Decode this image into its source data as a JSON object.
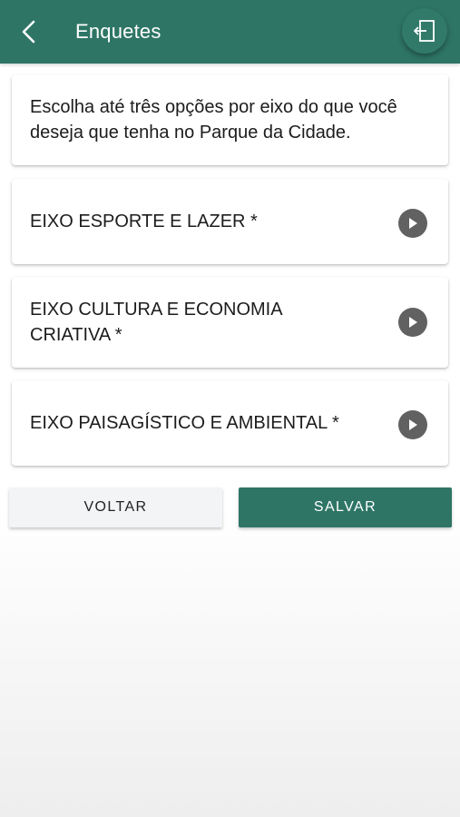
{
  "app_bar": {
    "title": "Enquetes",
    "back_icon": "chevron-left-icon",
    "exit_icon": "logout-icon",
    "background_color": "#2e7565"
  },
  "intro": {
    "text": "Escolha até três opções por eixo do que você deseja que tenha no Parque da Cidade."
  },
  "axes": [
    {
      "label": "EIXO ESPORTE E LAZER *",
      "icon": "play-circle-icon"
    },
    {
      "label": "EIXO CULTURA E ECONOMIA CRIATIVA *",
      "icon": "play-circle-icon"
    },
    {
      "label": "EIXO PAISAGÍSTICO E AMBIENTAL *",
      "icon": "play-circle-icon"
    }
  ],
  "actions": {
    "back_label": "VOLTAR",
    "save_label": "SALVAR",
    "save_color": "#2e7565"
  }
}
